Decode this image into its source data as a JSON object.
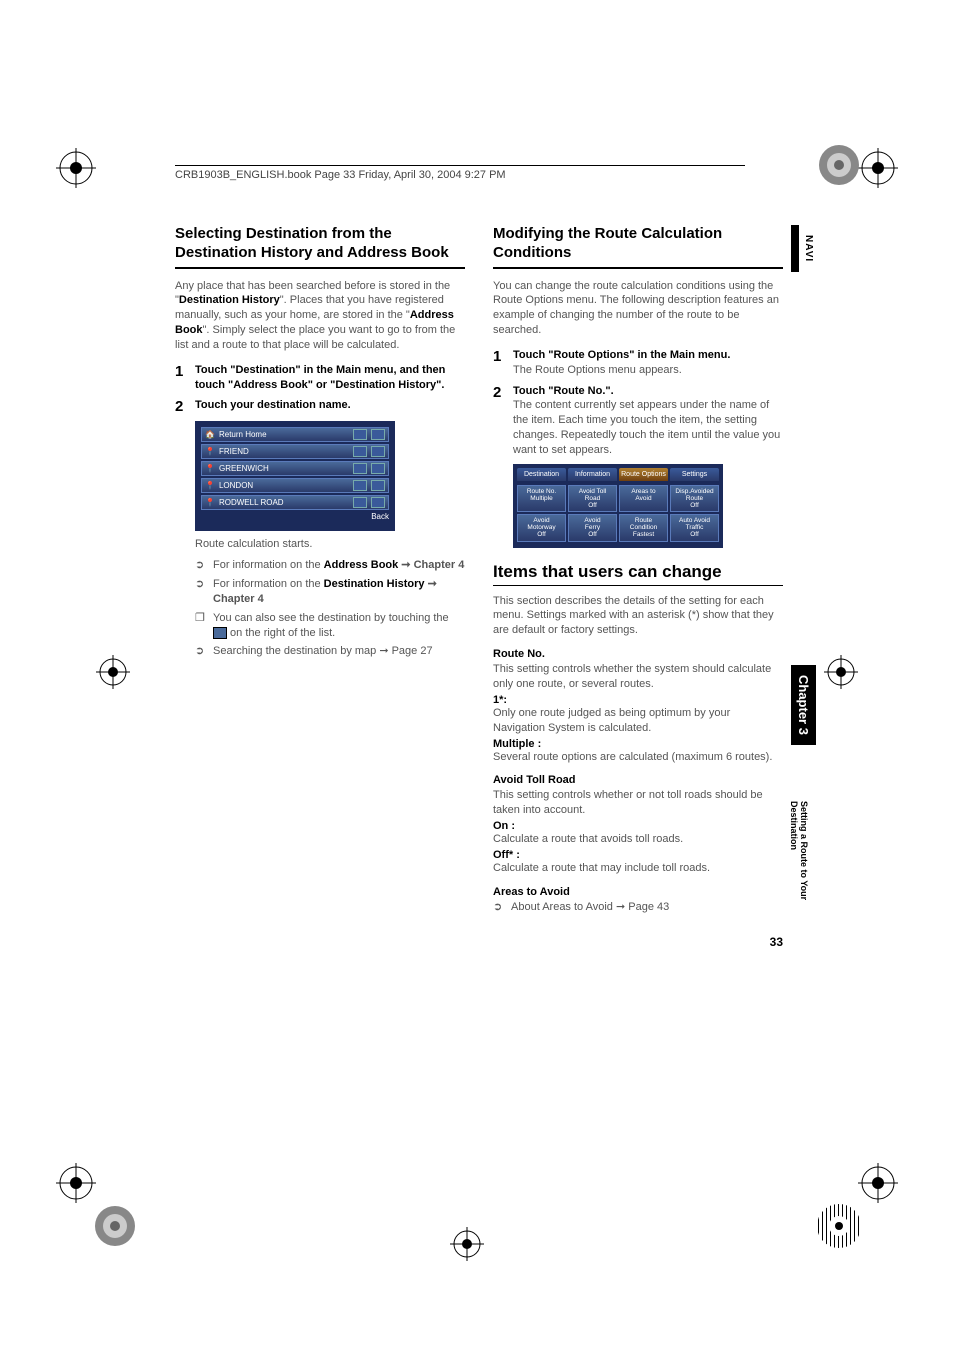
{
  "header": "CRB1903B_ENGLISH.book  Page 33  Friday, April 30, 2004  9:27 PM",
  "left": {
    "title": "Selecting Destination from the Destination History and Address Book",
    "intro_pre": "Any place that has been searched before is stored in the \"",
    "intro_b1": "Destination History",
    "intro_mid": "\". Places that you have registered manually, such as your home, are stored in the \"",
    "intro_b2": "Address Book",
    "intro_post": "\". Simply select the place you want to go to from the list and a route to that place will be calculated.",
    "step1": "Touch \"Destination\" in the Main menu, and then touch \"Address Book\" or \"Destination History\".",
    "step2": "Touch your destination name.",
    "rows": [
      "Return Home",
      "FRIEND",
      "GREENWICH",
      "LONDON",
      "RODWELL ROAD"
    ],
    "back": "Back",
    "calc": "Route calculation starts.",
    "b1_pre": "For information on the ",
    "b1_bold": "Address Book",
    "b1_post": " ➞ Chapter 4",
    "b2_pre": "For information on the ",
    "b2_bold": "Destination History",
    "b2_post": " ➞ Chapter 4",
    "b3_pre": "You can also see the destination by touching the ",
    "b3_post": " on the right of the list.",
    "b4": "Searching the destination by map ➞ Page 27"
  },
  "right": {
    "title": "Modifying the Route Calculation Conditions",
    "intro": "You can change the route calculation conditions using the Route Options menu. The following description features an example of changing the number of the route to be searched.",
    "step1": "Touch \"Route Options\" in the Main menu.",
    "step1_sub": "The Route Options menu appears.",
    "step2": "Touch \"Route No.\".",
    "step2_sub": "The content currently set appears under the name of the item. Each time you touch the item, the setting changes. Repeatedly touch the item until the value you want to set appears.",
    "tabs": [
      "Destination",
      "Information",
      "Route Options",
      "Settings"
    ],
    "grid": [
      [
        "Route No.\nMultiple",
        "Avoid Toll\nRoad\nOff",
        "Areas to\nAvoid",
        "Disp.Avoided\nRoute\nOff"
      ],
      [
        "Avoid\nMotorway\nOff",
        "Avoid\nFerry\nOff",
        "Route\nCondition\nFastest",
        "Auto Avoid\nTraffic\nOff"
      ]
    ],
    "items_title": "Items that users can change",
    "items_intro": "This section describes the details of the setting for each menu. Settings marked with an asterisk (*) show that they are default or factory settings.",
    "rn_head": "Route No.",
    "rn_body": "This setting controls whether the system should calculate only one route, or several routes.",
    "rn_1": "1*:",
    "rn_1_body": "Only one route judged as being optimum by your Navigation System is calculated.",
    "rn_m": "Multiple :",
    "rn_m_body": "Several route options are calculated (maximum 6 routes).",
    "atr_head": "Avoid Toll Road",
    "atr_body": "This setting controls whether or not toll roads should be taken into account.",
    "atr_on": "On :",
    "atr_on_body": "Calculate a route that avoids toll roads.",
    "atr_off": "Off* :",
    "atr_off_body": "Calculate a route that may include toll roads.",
    "ata_head": "Areas to Avoid",
    "ata_b": "About Areas to Avoid ➞ Page 43"
  },
  "side": {
    "navi": "NAVI",
    "chapter": "Chapter 3",
    "sub": "Setting a Route to Your Destination"
  },
  "page_num": "33"
}
